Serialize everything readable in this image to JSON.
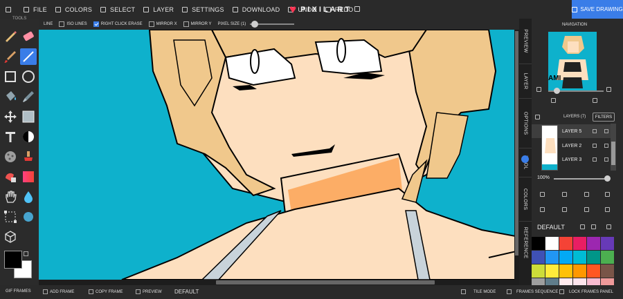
{
  "menu": {
    "items": [
      "FILE",
      "COLORS",
      "SELECT",
      "LAYER",
      "SETTINGS",
      "DOWNLOAD",
      "UNDO",
      "REDO"
    ],
    "logo": "PIXILART",
    "save_label": "SAVE DRAWING"
  },
  "tools": {
    "label": "TOOLS"
  },
  "options": {
    "mode": "LINE",
    "iso_lines": "ISO LINES",
    "right_click_erase": "RIGHT CLICK ERASE",
    "mirror_x": "MIRROR X",
    "mirror_y": "MIRROR Y",
    "pixel_size": "PIXEL SIZE (1)"
  },
  "side_tabs": [
    "PREVIEW",
    "LAYER",
    "OPTIONS",
    "TOOL",
    "COLORS",
    "REFERENCE"
  ],
  "navigation": {
    "title": "NAVIGATION",
    "thumb_text": "AMI"
  },
  "layers": {
    "title": "LAYERS (7)",
    "filters_label": "FILTERS",
    "items": [
      {
        "name": "LAYER 5"
      },
      {
        "name": "LAYER 2"
      },
      {
        "name": "LAYER 3"
      }
    ],
    "opacity": "100%"
  },
  "palette": {
    "name": "DEFAULT",
    "colors": [
      "#000000",
      "#ffffff",
      "#f44336",
      "#e91e63",
      "#9c27b0",
      "#673ab7",
      "#3f51b5",
      "#2196f3",
      "#03a9f4",
      "#00bcd4",
      "#009688",
      "#4caf50",
      "#cddc39",
      "#ffeb3b",
      "#ffc107",
      "#ff9800",
      "#ff5722",
      "#795548",
      "#9e9e9e",
      "#607d8b",
      "#ffebee",
      "#fce4ec",
      "#f8bbd0",
      "#ef9a9a"
    ]
  },
  "colors": {
    "accent": "#3a7de8",
    "canvas_bg": "#0eb1cc",
    "skin": "#fddfbf",
    "hair": "#f0c88c",
    "neck_shadow": "#fcad66"
  },
  "bottom": {
    "gif_frames": "GIF FRAMES",
    "add_frame": "ADD FRAME",
    "copy_frame": "COPY FRAME",
    "preview": "PREVIEW",
    "default": "DEFAULT",
    "tile_mode": "TILE MODE",
    "frames_sequence": "FRAMES SEQUENCE",
    "lock_frames": "LOCK FRAMES PANEL"
  }
}
